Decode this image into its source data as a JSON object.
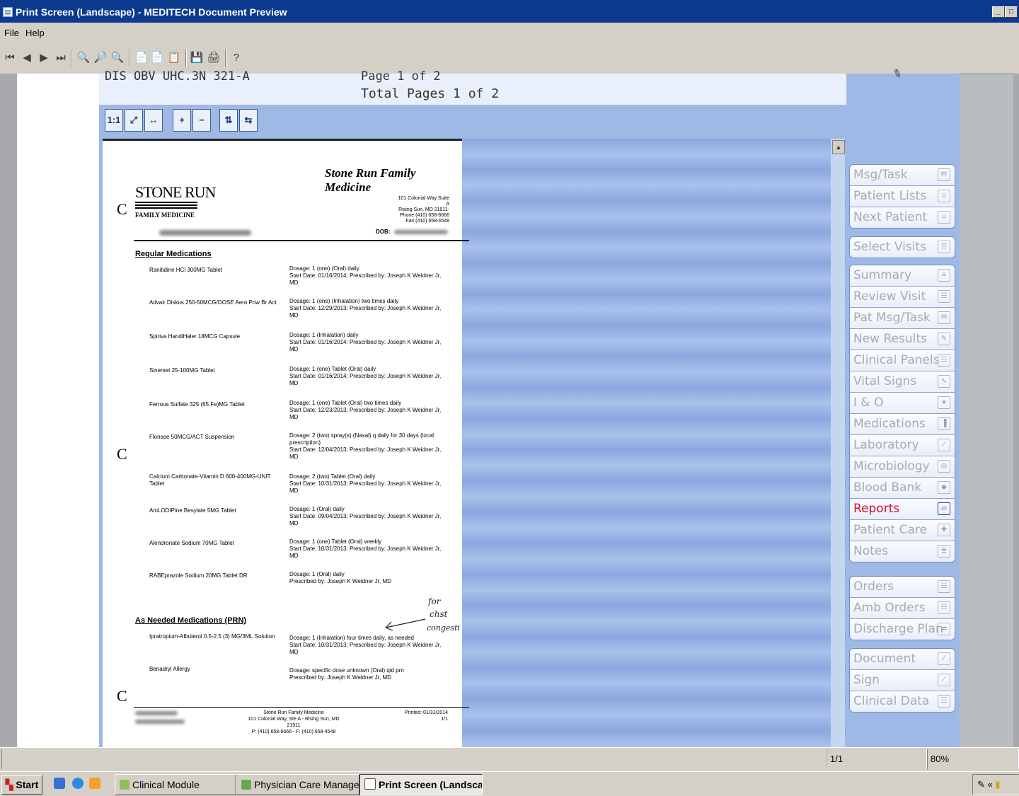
{
  "window": {
    "title": "Print Screen (Landscape) - MEDITECH Document Preview",
    "controls": [
      "_",
      "□"
    ]
  },
  "menu": [
    "File",
    "Help"
  ],
  "toolbar": {
    "icons": [
      "first-page-icon",
      "prev-page-icon",
      "next-page-icon",
      "last-page-icon",
      "zoom-in-icon",
      "zoom-out-icon",
      "zoom-reset-icon",
      "document-icon",
      "add-document-icon",
      "copy-icon",
      "save-icon",
      "print-icon",
      "help-icon"
    ],
    "glyphs": [
      "⏮",
      "◀",
      "▶",
      "⏭",
      "🔍",
      "🔎",
      "🔍",
      "📄",
      "📄",
      "📋",
      "💾",
      "🖨",
      "?"
    ]
  },
  "header": {
    "location": "DIS OBV UHC.3N 321-A",
    "page": "Page 1 of 2",
    "total": "Total Pages 1 of 2"
  },
  "viewer_tools": [
    "1:1",
    "⤢",
    "↔",
    "+",
    "−",
    "⇅",
    "⇆"
  ],
  "document": {
    "practice_name": "Stone Run Family Medicine",
    "logo_top": "STONE RUN",
    "logo_bottom": "FAMILY MEDICINE",
    "address": [
      "101 Colonial Way Suite A",
      "Rising Sun, MD 21911-",
      "Phone (410) 658-6666",
      "Fax (410) 658-4548"
    ],
    "dob_label": "DOB:",
    "regular_title": "Regular Medications",
    "regular": [
      {
        "name": "Ranitidine HCl 300MG Tablet",
        "dose": "Dosage: 1 (one) (Oral) daily",
        "start": "Start Date: 01/16/2014; Prescribed by: Joseph K Weidner Jr,",
        "md": "MD"
      },
      {
        "name": "Advair Diskus 250-50MCG/DOSE Aero Pow Br Act",
        "dose": "Dosage: 1 (one) (Inhalation) two times daily",
        "start": "Start Date: 12/29/2013; Prescribed by: Joseph K Weidner Jr,",
        "md": "MD"
      },
      {
        "name": "Spiriva HandiHaler 18MCG Capsule",
        "dose": "Dosage: 1 (Inhalation) daily",
        "start": "Start Date: 01/16/2014; Prescribed by: Joseph K Weidner Jr,",
        "md": "MD"
      },
      {
        "name": "Sinemet 25-100MG Tablet",
        "dose": "Dosage: 1 (one) Tablet (Oral) daily",
        "start": "Start Date: 01/16/2014; Prescribed by: Joseph K Weidner Jr,",
        "md": "MD"
      },
      {
        "name": "Ferrous Sulfate 325 (65 Fe)MG Tablet",
        "dose": "Dosage: 1 (one) Tablet (Oral) two times daily",
        "start": "Start Date: 12/23/2013; Prescribed by: Joseph K Weidner Jr,",
        "md": "MD"
      },
      {
        "name": "Flonase 50MCG/ACT Suspension",
        "dose": "Dosage: 2 (two) spray(s) (Nasal) q daily for 30 days (local prescription)",
        "start": "Start Date: 12/04/2013; Prescribed by: Joseph K Weidner Jr,",
        "md": "MD"
      },
      {
        "name": "Calcium Carbonate-Vitamin D 600-400MG-UNIT Tablet",
        "dose": "Dosage: 2 (two) Tablet (Oral) daily",
        "start": "Start Date: 10/31/2013; Prescribed by: Joseph K Weidner Jr,",
        "md": "MD"
      },
      {
        "name": "AmLODIPine Besylate 5MG Tablet",
        "dose": "Dosage: 1 (Oral) daily",
        "start": "Start Date: 09/04/2013; Prescribed by: Joseph K Weidner Jr,",
        "md": "MD"
      },
      {
        "name": "Alendronate Sodium 70MG Tablet",
        "dose": "Dosage: 1 (one) Tablet (Oral) weekly",
        "start": "Start Date: 10/31/2013; Prescribed by: Joseph K Weidner Jr,",
        "md": "MD"
      },
      {
        "name": "RABEprazole Sodium 20MG Tablet DR",
        "dose": "Dosage: 1 (Oral) daily",
        "start": "Prescribed by: Joseph K Weidner Jr, MD",
        "md": ""
      }
    ],
    "prn_title": "As Needed Medications (PRN)",
    "prn": [
      {
        "name": "Ipratropium-Albuterol 0.5-2.5 (3) MG/3ML Solution",
        "dose": "Dosage: 1 (Inhalation) four times daily, as needed",
        "start": "Start Date: 10/31/2013; Prescribed by: Joseph K Weidner Jr,",
        "md": "MD"
      },
      {
        "name": "Benadryl Allergy",
        "dose": "Dosage: specific dose unknown (Oral) qid prn",
        "start": "Prescribed by: Joseph K Weidner Jr, MD",
        "md": ""
      }
    ],
    "handwriting": [
      "for",
      "chst",
      "congesti"
    ],
    "footer_center": [
      "Stone Run Family Medicine",
      "101 Colonial Way, Ste A - Rising Sun, MD 21911",
      "P: (410) 658-6666 - F: (410) 658-4548"
    ],
    "footer_printed": "Printed: 01/31/2014",
    "footer_page": "1/1",
    "margin_mark": "C"
  },
  "sidebar": {
    "groups": [
      [
        {
          "label": "Msg/Task",
          "icon": "✉"
        },
        {
          "label": "Patient Lists",
          "icon": "☺"
        },
        {
          "label": "Next Patient",
          "icon": "☺"
        }
      ],
      [
        {
          "label": "Select Visits",
          "icon": "☰"
        }
      ],
      [
        {
          "label": "Summary",
          "icon": "≡"
        },
        {
          "label": "Review Visit",
          "icon": "☷"
        },
        {
          "label": "Pat Msg/Task",
          "icon": "✉"
        },
        {
          "label": "New Results",
          "icon": "✎"
        },
        {
          "label": "Clinical Panels",
          "icon": "☷"
        },
        {
          "label": "Vital Signs",
          "icon": "∿"
        },
        {
          "label": "I & O",
          "icon": "●"
        },
        {
          "label": "Medications",
          "icon": "▐"
        },
        {
          "label": "Laboratory",
          "icon": "∕"
        },
        {
          "label": "Microbiology",
          "icon": "◎"
        },
        {
          "label": "Blood Bank",
          "icon": "◆"
        },
        {
          "label": "Reports",
          "icon": "▱",
          "active": true
        },
        {
          "label": "Patient Care",
          "icon": "✚"
        },
        {
          "label": "Notes",
          "icon": "≣"
        }
      ],
      [
        {
          "label": "Orders",
          "icon": "☷"
        },
        {
          "label": "Amb Orders",
          "icon": "☷"
        },
        {
          "label": "Discharge Plan",
          "icon": "⇄"
        }
      ],
      [
        {
          "label": "Document",
          "icon": "∕"
        },
        {
          "label": "Sign",
          "icon": "∕"
        },
        {
          "label": "Clinical Data",
          "icon": "☷"
        }
      ]
    ]
  },
  "statusbar": {
    "page": "1/1",
    "zoom": "80%"
  },
  "taskbar": {
    "start": "Start",
    "tasks": [
      {
        "label": "Clinical Module",
        "active": false
      },
      {
        "label": "Physician Care Manager ...",
        "active": false
      },
      {
        "label": "Print Screen (Landsca...",
        "active": true
      }
    ],
    "tray": "«"
  }
}
